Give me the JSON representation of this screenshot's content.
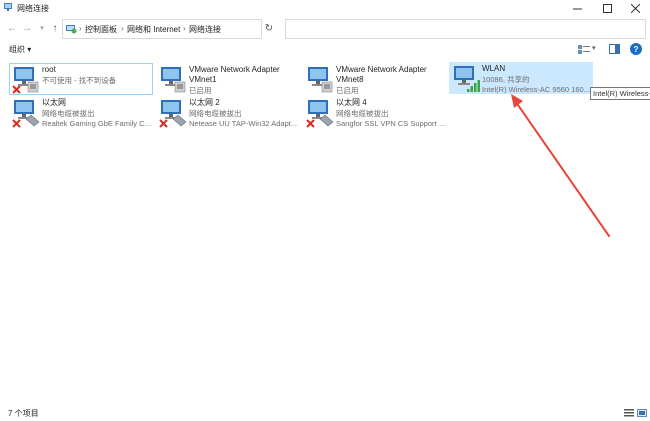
{
  "window": {
    "title": "网络连接"
  },
  "address": {
    "crumbs": [
      "控制面板",
      "网络和 Internet",
      "网络连接"
    ]
  },
  "toolbar": {
    "organize_label": "组织 ▾",
    "help_label": "?"
  },
  "items": [
    {
      "name": "root",
      "status": "不可使用 - 找不到设备",
      "device": "",
      "state": "unavailable"
    },
    {
      "name": "VMware Network Adapter VMnet1",
      "status": "已启用",
      "device": "",
      "state": "enabled"
    },
    {
      "name": "VMware Network Adapter VMnet8",
      "status": "已启用",
      "device": "",
      "state": "enabled"
    },
    {
      "name": "WLAN",
      "status": "10086, 共享的",
      "device": "Intel(R) Wireless-AC 9560 160...",
      "state": "wireless"
    },
    {
      "name": "以太网",
      "status": "网络电缆被拔出",
      "device": "Realtek Gaming GbE Family Co...",
      "state": "unplugged"
    },
    {
      "name": "以太网 2",
      "status": "网络电缆被拔出",
      "device": "Netease UU TAP-Win32 Adapt...",
      "state": "unplugged"
    },
    {
      "name": "以太网 4",
      "status": "网络电缆被拔出",
      "device": "Sangfor SSL VPN CS Support S...",
      "state": "unplugged"
    }
  ],
  "tooltip": {
    "text": "Intel(R) Wireless-AC"
  },
  "status": {
    "item_count": "7 个项目"
  },
  "colors": {
    "selection": "#cce8ff",
    "accent_blue": "#1a6fc2",
    "arrow_red": "#e8453c"
  }
}
